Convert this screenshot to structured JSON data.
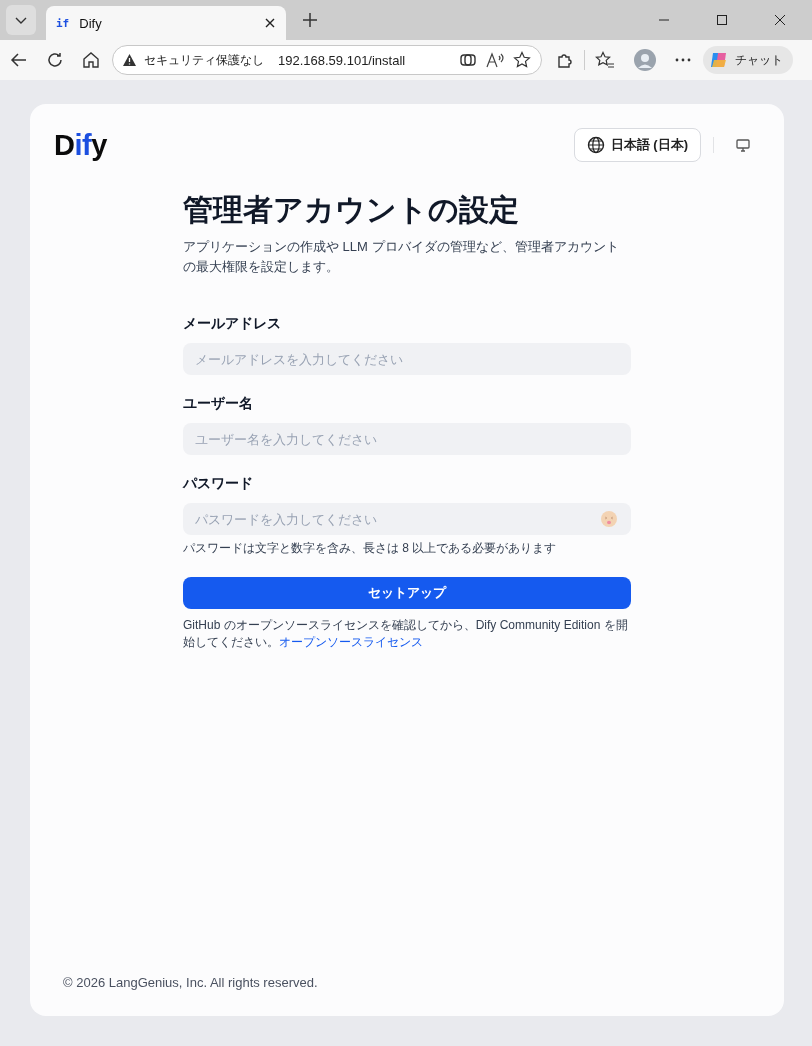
{
  "browser": {
    "tab": {
      "title": "Dify",
      "favicon": "if"
    },
    "address": {
      "security": "セキュリティ保護なし",
      "url": "192.168.59.101/install"
    },
    "copilot": "チャット"
  },
  "header": {
    "logo": [
      {
        "text": "D",
        "accent": false
      },
      {
        "text": "if",
        "accent": true
      },
      {
        "text": "y",
        "accent": false
      }
    ],
    "language": "日本語 (日本)"
  },
  "title": "管理者アカウントの設定",
  "subtitle": "アプリケーションの作成や LLM プロバイダの管理など、管理者アカウントの最大権限を設定します。",
  "fields": [
    {
      "label": "メールアドレス",
      "placeholder": "メールアドレスを入力してください",
      "kind": "text"
    },
    {
      "label": "ユーザー名",
      "placeholder": "ユーザー名を入力してください",
      "kind": "text"
    },
    {
      "label": "パスワード",
      "placeholder": "パスワードを入力してください",
      "kind": "password",
      "hint": "パスワードは文字と数字を含み、長さは 8 以上である必要があります"
    }
  ],
  "submit": "セットアップ",
  "license": {
    "text": "GitHub のオープンソースライセンスを確認してから、Dify Community Edition を開始してください。",
    "link": "オープンソースライセンス"
  },
  "footer": "© 2026 LangGenius, Inc. All rights reserved."
}
